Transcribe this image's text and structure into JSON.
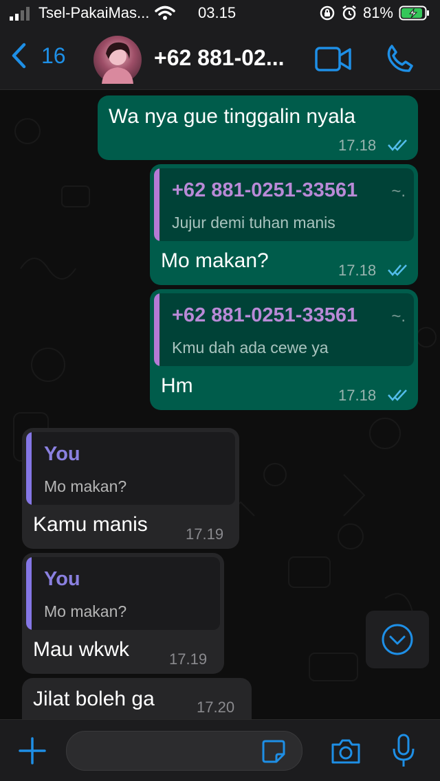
{
  "status_bar": {
    "carrier": "Tsel-PakaiMas...",
    "time": "03.15",
    "battery": "81%"
  },
  "header": {
    "back_count": "16",
    "contact_name": "+62 881-02..."
  },
  "messages": [
    {
      "direction": "out",
      "text": "Wa nya gue tinggalin nyala",
      "time": "17.18"
    },
    {
      "direction": "out",
      "quote_name": "+62 881-0251-33561",
      "quote_suffix": "~.",
      "quote_text": "Jujur demi tuhan manis",
      "text": "Mo makan?",
      "time": "17.18"
    },
    {
      "direction": "out",
      "quote_name": "+62 881-0251-33561",
      "quote_suffix": "~.",
      "quote_text": "Kmu dah ada cewe ya",
      "text": "Hm",
      "time": "17.18"
    },
    {
      "direction": "in",
      "quote_name": "You",
      "quote_text": "Mo makan?",
      "text": "Kamu manis",
      "time": "17.19"
    },
    {
      "direction": "in",
      "quote_name": "You",
      "quote_text": "Mo makan?",
      "text": "Mau wkwk",
      "time": "17.19"
    },
    {
      "direction": "in",
      "text": "Jilat boleh ga",
      "time": "17.20"
    }
  ],
  "composer": {
    "input_value": ""
  },
  "colors": {
    "accent": "#1e8fe6",
    "outgoing_bubble": "#005c4b",
    "incoming_bubble": "#262628",
    "quote_bar_contact": "#b57ad6",
    "quote_name_contact": "#b98ad7",
    "quote_name_you": "#8a80e0",
    "quote_bar_you": "#8577e6",
    "read_ticks": "#53bdeb"
  },
  "icons": [
    "signal-icon",
    "wifi-icon",
    "rotation-lock-icon",
    "alarm-icon",
    "battery-icon",
    "back-chevron-icon",
    "video-call-icon",
    "phone-icon",
    "double-check-icon",
    "scroll-down-icon",
    "plus-icon",
    "sticker-icon",
    "camera-icon",
    "microphone-icon"
  ]
}
